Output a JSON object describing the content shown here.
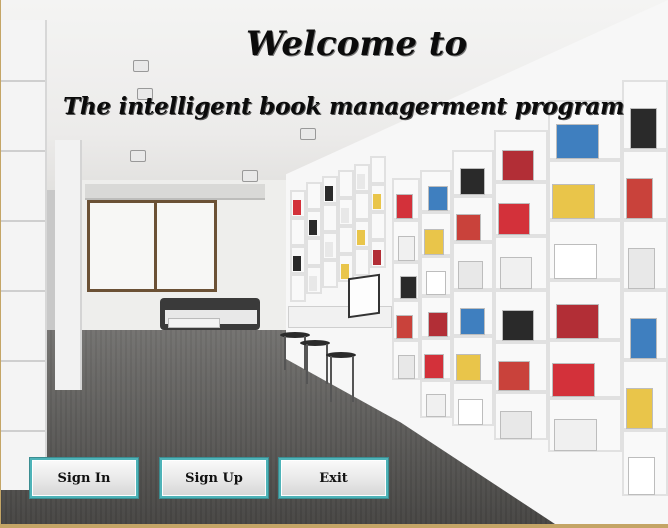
{
  "window": {
    "heading_line1": "Welcome to",
    "heading_line2": "The intelligent book managerment program"
  },
  "background": {
    "description_icon": "bookstore-photo"
  },
  "buttons": {
    "sign_in": "Sign In",
    "sign_up": "Sign Up",
    "exit": "Exit"
  },
  "colors": {
    "button_border": "#4eb3b8",
    "text": "#0b0b0b",
    "frame_accent": "#c4a566"
  }
}
